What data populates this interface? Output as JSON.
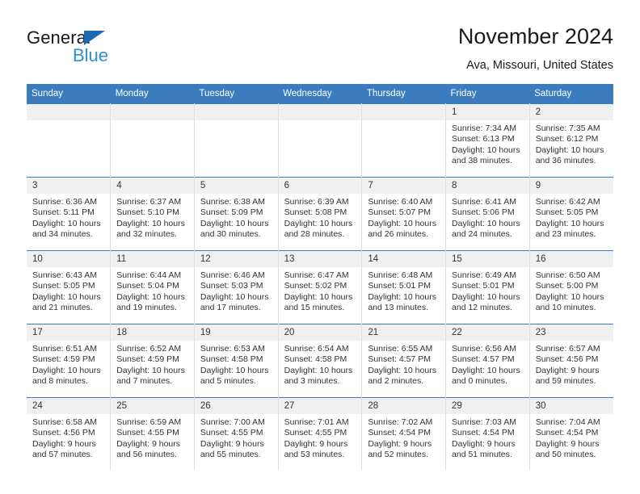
{
  "brand": {
    "name_part1": "General",
    "name_part2": "Blue",
    "accent_color": "#2e8fd6",
    "triangle_color": "#1b69b3",
    "triangle_icon": "triangle-icon"
  },
  "header": {
    "month_title": "November 2024",
    "location": "Ava, Missouri, United States"
  },
  "calendar": {
    "header_bg": "#3b7cbe",
    "daynum_bg": "#f0f0f0",
    "weekday_headers": [
      "Sunday",
      "Monday",
      "Tuesday",
      "Wednesday",
      "Thursday",
      "Friday",
      "Saturday"
    ],
    "weeks": [
      [
        {
          "day": "",
          "empty": true,
          "sunrise": "",
          "sunset": "",
          "daylight_line1": "",
          "daylight_line2": ""
        },
        {
          "day": "",
          "empty": true,
          "sunrise": "",
          "sunset": "",
          "daylight_line1": "",
          "daylight_line2": ""
        },
        {
          "day": "",
          "empty": true,
          "sunrise": "",
          "sunset": "",
          "daylight_line1": "",
          "daylight_line2": ""
        },
        {
          "day": "",
          "empty": true,
          "sunrise": "",
          "sunset": "",
          "daylight_line1": "",
          "daylight_line2": ""
        },
        {
          "day": "",
          "empty": true,
          "sunrise": "",
          "sunset": "",
          "daylight_line1": "",
          "daylight_line2": ""
        },
        {
          "day": "1",
          "empty": false,
          "sunrise": "Sunrise: 7:34 AM",
          "sunset": "Sunset: 6:13 PM",
          "daylight_line1": "Daylight: 10 hours",
          "daylight_line2": "and 38 minutes."
        },
        {
          "day": "2",
          "empty": false,
          "sunrise": "Sunrise: 7:35 AM",
          "sunset": "Sunset: 6:12 PM",
          "daylight_line1": "Daylight: 10 hours",
          "daylight_line2": "and 36 minutes."
        }
      ],
      [
        {
          "day": "3",
          "empty": false,
          "sunrise": "Sunrise: 6:36 AM",
          "sunset": "Sunset: 5:11 PM",
          "daylight_line1": "Daylight: 10 hours",
          "daylight_line2": "and 34 minutes."
        },
        {
          "day": "4",
          "empty": false,
          "sunrise": "Sunrise: 6:37 AM",
          "sunset": "Sunset: 5:10 PM",
          "daylight_line1": "Daylight: 10 hours",
          "daylight_line2": "and 32 minutes."
        },
        {
          "day": "5",
          "empty": false,
          "sunrise": "Sunrise: 6:38 AM",
          "sunset": "Sunset: 5:09 PM",
          "daylight_line1": "Daylight: 10 hours",
          "daylight_line2": "and 30 minutes."
        },
        {
          "day": "6",
          "empty": false,
          "sunrise": "Sunrise: 6:39 AM",
          "sunset": "Sunset: 5:08 PM",
          "daylight_line1": "Daylight: 10 hours",
          "daylight_line2": "and 28 minutes."
        },
        {
          "day": "7",
          "empty": false,
          "sunrise": "Sunrise: 6:40 AM",
          "sunset": "Sunset: 5:07 PM",
          "daylight_line1": "Daylight: 10 hours",
          "daylight_line2": "and 26 minutes."
        },
        {
          "day": "8",
          "empty": false,
          "sunrise": "Sunrise: 6:41 AM",
          "sunset": "Sunset: 5:06 PM",
          "daylight_line1": "Daylight: 10 hours",
          "daylight_line2": "and 24 minutes."
        },
        {
          "day": "9",
          "empty": false,
          "sunrise": "Sunrise: 6:42 AM",
          "sunset": "Sunset: 5:05 PM",
          "daylight_line1": "Daylight: 10 hours",
          "daylight_line2": "and 23 minutes."
        }
      ],
      [
        {
          "day": "10",
          "empty": false,
          "sunrise": "Sunrise: 6:43 AM",
          "sunset": "Sunset: 5:05 PM",
          "daylight_line1": "Daylight: 10 hours",
          "daylight_line2": "and 21 minutes."
        },
        {
          "day": "11",
          "empty": false,
          "sunrise": "Sunrise: 6:44 AM",
          "sunset": "Sunset: 5:04 PM",
          "daylight_line1": "Daylight: 10 hours",
          "daylight_line2": "and 19 minutes."
        },
        {
          "day": "12",
          "empty": false,
          "sunrise": "Sunrise: 6:46 AM",
          "sunset": "Sunset: 5:03 PM",
          "daylight_line1": "Daylight: 10 hours",
          "daylight_line2": "and 17 minutes."
        },
        {
          "day": "13",
          "empty": false,
          "sunrise": "Sunrise: 6:47 AM",
          "sunset": "Sunset: 5:02 PM",
          "daylight_line1": "Daylight: 10 hours",
          "daylight_line2": "and 15 minutes."
        },
        {
          "day": "14",
          "empty": false,
          "sunrise": "Sunrise: 6:48 AM",
          "sunset": "Sunset: 5:01 PM",
          "daylight_line1": "Daylight: 10 hours",
          "daylight_line2": "and 13 minutes."
        },
        {
          "day": "15",
          "empty": false,
          "sunrise": "Sunrise: 6:49 AM",
          "sunset": "Sunset: 5:01 PM",
          "daylight_line1": "Daylight: 10 hours",
          "daylight_line2": "and 12 minutes."
        },
        {
          "day": "16",
          "empty": false,
          "sunrise": "Sunrise: 6:50 AM",
          "sunset": "Sunset: 5:00 PM",
          "daylight_line1": "Daylight: 10 hours",
          "daylight_line2": "and 10 minutes."
        }
      ],
      [
        {
          "day": "17",
          "empty": false,
          "sunrise": "Sunrise: 6:51 AM",
          "sunset": "Sunset: 4:59 PM",
          "daylight_line1": "Daylight: 10 hours",
          "daylight_line2": "and 8 minutes."
        },
        {
          "day": "18",
          "empty": false,
          "sunrise": "Sunrise: 6:52 AM",
          "sunset": "Sunset: 4:59 PM",
          "daylight_line1": "Daylight: 10 hours",
          "daylight_line2": "and 7 minutes."
        },
        {
          "day": "19",
          "empty": false,
          "sunrise": "Sunrise: 6:53 AM",
          "sunset": "Sunset: 4:58 PM",
          "daylight_line1": "Daylight: 10 hours",
          "daylight_line2": "and 5 minutes."
        },
        {
          "day": "20",
          "empty": false,
          "sunrise": "Sunrise: 6:54 AM",
          "sunset": "Sunset: 4:58 PM",
          "daylight_line1": "Daylight: 10 hours",
          "daylight_line2": "and 3 minutes."
        },
        {
          "day": "21",
          "empty": false,
          "sunrise": "Sunrise: 6:55 AM",
          "sunset": "Sunset: 4:57 PM",
          "daylight_line1": "Daylight: 10 hours",
          "daylight_line2": "and 2 minutes."
        },
        {
          "day": "22",
          "empty": false,
          "sunrise": "Sunrise: 6:56 AM",
          "sunset": "Sunset: 4:57 PM",
          "daylight_line1": "Daylight: 10 hours",
          "daylight_line2": "and 0 minutes."
        },
        {
          "day": "23",
          "empty": false,
          "sunrise": "Sunrise: 6:57 AM",
          "sunset": "Sunset: 4:56 PM",
          "daylight_line1": "Daylight: 9 hours",
          "daylight_line2": "and 59 minutes."
        }
      ],
      [
        {
          "day": "24",
          "empty": false,
          "sunrise": "Sunrise: 6:58 AM",
          "sunset": "Sunset: 4:56 PM",
          "daylight_line1": "Daylight: 9 hours",
          "daylight_line2": "and 57 minutes."
        },
        {
          "day": "25",
          "empty": false,
          "sunrise": "Sunrise: 6:59 AM",
          "sunset": "Sunset: 4:55 PM",
          "daylight_line1": "Daylight: 9 hours",
          "daylight_line2": "and 56 minutes."
        },
        {
          "day": "26",
          "empty": false,
          "sunrise": "Sunrise: 7:00 AM",
          "sunset": "Sunset: 4:55 PM",
          "daylight_line1": "Daylight: 9 hours",
          "daylight_line2": "and 55 minutes."
        },
        {
          "day": "27",
          "empty": false,
          "sunrise": "Sunrise: 7:01 AM",
          "sunset": "Sunset: 4:55 PM",
          "daylight_line1": "Daylight: 9 hours",
          "daylight_line2": "and 53 minutes."
        },
        {
          "day": "28",
          "empty": false,
          "sunrise": "Sunrise: 7:02 AM",
          "sunset": "Sunset: 4:54 PM",
          "daylight_line1": "Daylight: 9 hours",
          "daylight_line2": "and 52 minutes."
        },
        {
          "day": "29",
          "empty": false,
          "sunrise": "Sunrise: 7:03 AM",
          "sunset": "Sunset: 4:54 PM",
          "daylight_line1": "Daylight: 9 hours",
          "daylight_line2": "and 51 minutes."
        },
        {
          "day": "30",
          "empty": false,
          "sunrise": "Sunrise: 7:04 AM",
          "sunset": "Sunset: 4:54 PM",
          "daylight_line1": "Daylight: 9 hours",
          "daylight_line2": "and 50 minutes."
        }
      ]
    ]
  }
}
